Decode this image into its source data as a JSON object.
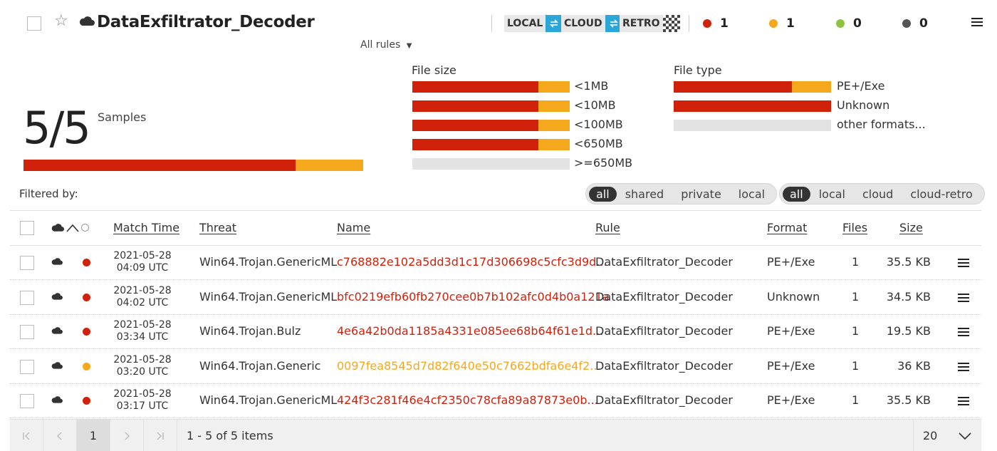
{
  "header": {
    "title": "DataExfiltrator_Decoder",
    "tags": [
      "LOCAL",
      "CLOUD",
      "RETRO"
    ],
    "counts": [
      {
        "value": "1",
        "color": "#d0210b"
      },
      {
        "value": "1",
        "color": "#f5a81c"
      },
      {
        "value": "0",
        "color": "#8cc43d"
      },
      {
        "value": "0",
        "color": "#555555"
      }
    ],
    "rules_filter": "All rules"
  },
  "samples": {
    "count": "5/5",
    "label": "Samples",
    "bar": {
      "red_fraction": 0.8,
      "orange_fraction": 0.2
    }
  },
  "file_size": {
    "label": "File size",
    "items": [
      {
        "label": "<1MB",
        "red_fraction": 0.8,
        "orange_fraction": 0.2
      },
      {
        "label": "<10MB",
        "red_fraction": 0.8,
        "orange_fraction": 0.2
      },
      {
        "label": "<100MB",
        "red_fraction": 0.8,
        "orange_fraction": 0.2
      },
      {
        "label": "<650MB",
        "red_fraction": 0.8,
        "orange_fraction": 0.2
      },
      {
        "label": ">=650MB",
        "red_fraction": 0,
        "orange_fraction": 0
      }
    ]
  },
  "file_type": {
    "label": "File type",
    "items": [
      {
        "label": "PE+/Exe",
        "red_fraction": 0.75,
        "orange_fraction": 0.25
      },
      {
        "label": "Unknown",
        "red_fraction": 1.0,
        "orange_fraction": 0
      },
      {
        "label": "other formats...",
        "red_fraction": 0,
        "orange_fraction": 0
      }
    ]
  },
  "filters": {
    "label": "Filtered by:",
    "scope": [
      "all",
      "shared",
      "private",
      "local"
    ],
    "source": [
      "all",
      "local",
      "cloud",
      "cloud-retro"
    ]
  },
  "table": {
    "columns": [
      "Match Time",
      "Threat",
      "Name",
      "Rule",
      "Format",
      "Files",
      "Size"
    ],
    "rows": [
      {
        "date": "2021-05-28",
        "time": "04:09 UTC",
        "threat": "Win64.Trojan.GenericML",
        "name": "c768882e102a5dd3d1c17d306698c5cfc3d9d...",
        "rule": "DataExfiltrator_Decoder",
        "format": "PE+/Exe",
        "files": "1",
        "size": "35.5 KB",
        "severity": "#d0210b"
      },
      {
        "date": "2021-05-28",
        "time": "04:02 UTC",
        "threat": "Win64.Trojan.GenericML",
        "name": "bfc0219efb60fb270cee0b7b102afc0d4b0a121a",
        "rule": "DataExfiltrator_Decoder",
        "format": "Unknown",
        "files": "1",
        "size": "34.5 KB",
        "severity": "#d0210b"
      },
      {
        "date": "2021-05-28",
        "time": "03:34 UTC",
        "threat": "Win64.Trojan.Bulz",
        "name": "4e6a42b0da1185a4331e085ee68b64f61e1d...",
        "rule": "DataExfiltrator_Decoder",
        "format": "PE+/Exe",
        "files": "1",
        "size": "19.5 KB",
        "severity": "#d0210b"
      },
      {
        "date": "2021-05-28",
        "time": "03:20 UTC",
        "threat": "Win64.Trojan.Generic",
        "name": "0097fea8545d7d82f640e50c7662bdfa6e4f2...",
        "rule": "DataExfiltrator_Decoder",
        "format": "PE+/Exe",
        "files": "1",
        "size": "36 KB",
        "severity": "#f5a81c"
      },
      {
        "date": "2021-05-28",
        "time": "03:17 UTC",
        "threat": "Win64.Trojan.GenericML",
        "name": "424f3c281f46e4cf2350c78cfa89a87873e0b...",
        "rule": "DataExfiltrator_Decoder",
        "format": "PE+/Exe",
        "files": "1",
        "size": "35.5 KB",
        "severity": "#d0210b"
      }
    ]
  },
  "pager": {
    "current_page": "1",
    "summary": "1 - 5 of 5 items",
    "page_size": "20"
  }
}
